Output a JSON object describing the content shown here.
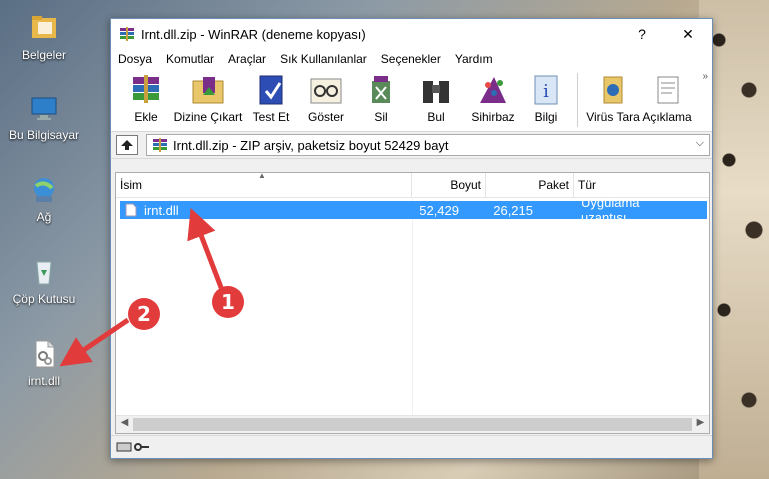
{
  "desktop": {
    "icons": [
      {
        "label": "Belgeler",
        "icon": "folder-icon"
      },
      {
        "label": "Bu Bilgisayar",
        "icon": "computer-icon"
      },
      {
        "label": "Ağ",
        "icon": "network-icon"
      },
      {
        "label": "Çöp Kutusu",
        "icon": "recycle-bin-icon"
      },
      {
        "label": "irnt.dll",
        "icon": "dll-file-icon"
      }
    ]
  },
  "window": {
    "title": "Irnt.dll.zip - WinRAR (deneme kopyası)",
    "help_button": "?",
    "close_button": "✕",
    "menu": [
      "Dosya",
      "Komutlar",
      "Araçlar",
      "Sık Kullanılanlar",
      "Seçenekler",
      "Yardım"
    ],
    "toolbar": [
      {
        "label": "Ekle",
        "icon": "books-add-icon"
      },
      {
        "label": "Dizine Çıkart",
        "icon": "extract-folder-icon"
      },
      {
        "label": "Test Et",
        "icon": "test-book-icon"
      },
      {
        "label": "Göster",
        "icon": "view-glasses-icon"
      },
      {
        "label": "Sil",
        "icon": "delete-icon"
      },
      {
        "label": "Bul",
        "icon": "binoculars-icon"
      },
      {
        "label": "Sihirbaz",
        "icon": "wizard-icon"
      },
      {
        "label": "Bilgi",
        "icon": "info-icon"
      },
      {
        "label": "Virüs Tara",
        "icon": "virus-scan-icon"
      },
      {
        "label": "Açıklama",
        "icon": "comment-icon"
      }
    ],
    "toolbar_more": "»",
    "address": "Irnt.dll.zip - ZIP arşiv, paketsiz boyut 52429 bayt",
    "columns": [
      "İsim",
      "Boyut",
      "Paket",
      "Tür"
    ],
    "rows": [
      {
        "name": "irnt.dll",
        "size": "52,429",
        "packed": "26,215",
        "type": "Uygulama uzantısı",
        "selected": true
      }
    ]
  },
  "annotations": {
    "step1": "1",
    "step2": "2",
    "arrow_color": "#e23b3b"
  },
  "colors": {
    "selection": "#3399ff",
    "window_border": "#6d8fb3"
  }
}
